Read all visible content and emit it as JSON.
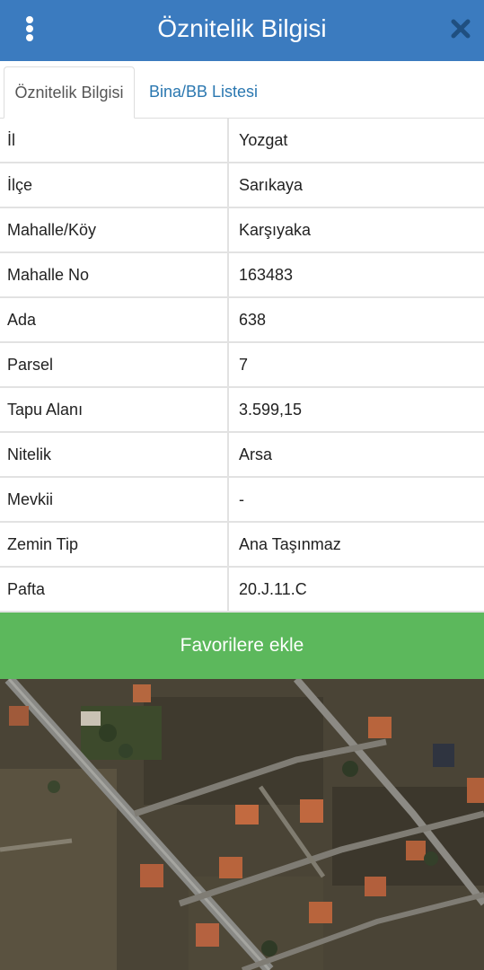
{
  "header": {
    "title": "Öznitelik Bilgisi",
    "menu_icon": "vertical-dots-icon",
    "close_icon": "close-icon",
    "color": "#3b7bbf"
  },
  "tabs": [
    {
      "label": "Öznitelik Bilgisi",
      "active": true
    },
    {
      "label": "Bina/BB Listesi",
      "active": false
    }
  ],
  "attributes": [
    {
      "key": "İl",
      "value": "Yozgat"
    },
    {
      "key": "İlçe",
      "value": "Sarıkaya"
    },
    {
      "key": "Mahalle/Köy",
      "value": "Karşıyaka"
    },
    {
      "key": "Mahalle No",
      "value": "163483"
    },
    {
      "key": "Ada",
      "value": "638"
    },
    {
      "key": "Parsel",
      "value": "7"
    },
    {
      "key": "Tapu Alanı",
      "value": "3.599,15"
    },
    {
      "key": "Nitelik",
      "value": "Arsa"
    },
    {
      "key": "Mevkii",
      "value": "-"
    },
    {
      "key": "Zemin Tip",
      "value": "Ana Taşınmaz"
    },
    {
      "key": "Pafta",
      "value": "20.J.11.C"
    }
  ],
  "favorite_button": {
    "label": "Favorilere ekle",
    "color": "#5cb85c"
  }
}
